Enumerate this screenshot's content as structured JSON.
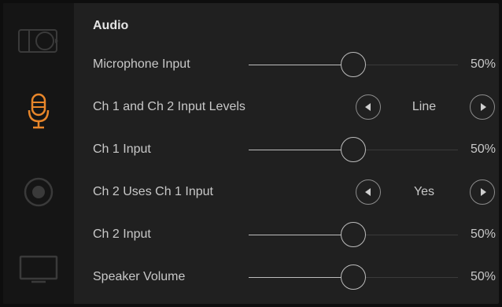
{
  "sidebar": {
    "items": [
      {
        "icon": "camera-icon",
        "active": false
      },
      {
        "icon": "microphone-icon",
        "active": true
      },
      {
        "icon": "record-icon",
        "active": false
      },
      {
        "icon": "monitor-icon",
        "active": false
      }
    ],
    "accent_color": "#e8862a"
  },
  "audio": {
    "title": "Audio",
    "microphone_input": {
      "label": "Microphone Input",
      "value": "50%",
      "level": 0.5
    },
    "ch1_ch2_input_levels": {
      "label": "Ch 1 and Ch 2 Input Levels",
      "value": "Line"
    },
    "ch1_input": {
      "label": "Ch 1 Input",
      "value": "50%",
      "level": 0.5
    },
    "ch2_uses_ch1_input": {
      "label": "Ch 2 Uses Ch 1 Input",
      "value": "Yes"
    },
    "ch2_input": {
      "label": "Ch 2 Input",
      "value": "50%",
      "level": 0.5
    },
    "speaker_volume": {
      "label": "Speaker Volume",
      "value": "50%",
      "level": 0.5
    }
  }
}
